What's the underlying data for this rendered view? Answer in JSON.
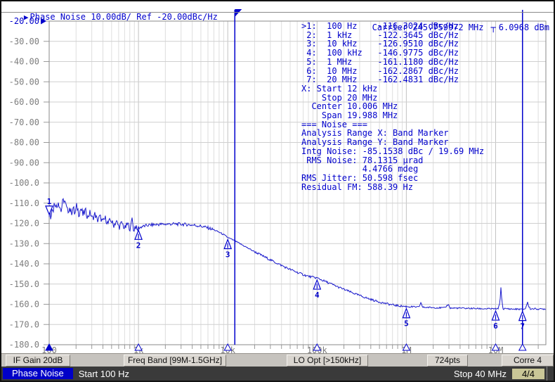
{
  "header": {
    "pointer_symbol": "▶",
    "title": "Phase Noise 10.00dB/ Ref -20.00dBc/Hz",
    "carrier": "Carrier 245.759972 MHz",
    "carrier_level_symbol": "┬",
    "power": "6.0968 dBm"
  },
  "info_panel": {
    "lines": [
      ">1:  100 Hz    -116.3024 dBc/Hz",
      " 2:  1 kHz     -122.3645 dBc/Hz",
      " 3:  10 kHz    -126.9510 dBc/Hz",
      " 4:  100 kHz   -146.9775 dBc/Hz",
      " 5:  1 MHz     -161.1180 dBc/Hz",
      " 6:  10 MHz    -162.2867 dBc/Hz",
      " 7:  20 MHz    -162.4831 dBc/Hz",
      "X: Start 12 kHz",
      "    Stop 20 MHz",
      "  Center 10.006 MHz",
      "    Span 19.988 MHz",
      "=== Noise ===",
      "Analysis Range X: Band Marker",
      "Analysis Range Y: Band Marker",
      "Intg Noise: -85.1538 dBc / 19.69 MHz",
      " RMS Noise: 78.1315 µrad",
      "            4.4766 mdeg",
      "RMS Jitter: 50.598 fsec",
      "Residual FM: 588.39 Hz"
    ]
  },
  "softkeys": [
    "IF Gain 20dB",
    "Freq Band [99M-1.5GHz]",
    "LO Opt [>150kHz]",
    "724pts",
    "Corre 4"
  ],
  "statusbar": {
    "mode": "Phase Noise",
    "start": "Start 100 Hz",
    "stop": "Stop 40 MHz",
    "page": "4/4"
  },
  "colors": {
    "accent": "#0000cc",
    "trace": "#1a1acc",
    "axis_text": "#7d7d7d",
    "grid_minor": "#dedede",
    "grid_major": "#c2c2c2",
    "grid_h": "#cfcfcf",
    "frame": "#8a8a8a",
    "tick": "#9a9a9a",
    "status_bg": "#3a3a3a",
    "page_chip_bg": "#c9c697",
    "mode_chip_bg": "#0000c8"
  },
  "chart_data": {
    "type": "line",
    "title": "Phase Noise 10.00dB/ Ref -20.00dBc/Hz",
    "x_scale": "log",
    "x_range_hz": [
      100,
      40000000
    ],
    "x_tick_values": [
      100,
      1000,
      10000,
      100000,
      1000000,
      10000000
    ],
    "x_tick_labels": [
      "100",
      "1k",
      "10k",
      "100k",
      "1M",
      "10M"
    ],
    "y_unit": "dBc/Hz",
    "y_range": [
      -180,
      -20
    ],
    "scale_per_div_db": 10,
    "ref_level_db": -20,
    "grid": true,
    "y_tick_labels": [
      "-20.00",
      "-30.00",
      "-40.00",
      "-50.00",
      "-60.00",
      "-70.00",
      "-80.00",
      "-90.00",
      "-100.0",
      "-110.0",
      "-120.0",
      "-130.0",
      "-140.0",
      "-150.0",
      "-160.0",
      "-170.0",
      "-180.0"
    ],
    "band_marker_start_hz": 12000,
    "band_marker_stop_hz": 20000000,
    "markers": [
      {
        "n": 1,
        "freq_hz": 100,
        "dbc_hz": -116.3024,
        "selected": true
      },
      {
        "n": 2,
        "freq_hz": 1000,
        "dbc_hz": -122.3645,
        "selected": false
      },
      {
        "n": 3,
        "freq_hz": 10000,
        "dbc_hz": -126.951,
        "selected": false
      },
      {
        "n": 4,
        "freq_hz": 100000,
        "dbc_hz": -146.9775,
        "selected": false
      },
      {
        "n": 5,
        "freq_hz": 1000000,
        "dbc_hz": -161.118,
        "selected": false
      },
      {
        "n": 6,
        "freq_hz": 10000000,
        "dbc_hz": -162.2867,
        "selected": false
      },
      {
        "n": 7,
        "freq_hz": 20000000,
        "dbc_hz": -162.4831,
        "selected": false
      }
    ],
    "trace": [
      [
        100,
        -116.3
      ],
      [
        102,
        -110.6
      ],
      [
        104,
        -117.6
      ],
      [
        107,
        -111.2
      ],
      [
        110,
        -114.5
      ],
      [
        113,
        -111.0
      ],
      [
        117,
        -109.2
      ],
      [
        121,
        -112.8
      ],
      [
        126,
        -108.4
      ],
      [
        131,
        -111.5
      ],
      [
        136,
        -113.8
      ],
      [
        141,
        -110.2
      ],
      [
        147,
        -108.0
      ],
      [
        153,
        -111.0
      ],
      [
        160,
        -114.2
      ],
      [
        168,
        -111.8
      ],
      [
        176,
        -114.8
      ],
      [
        185,
        -112.2
      ],
      [
        194,
        -115.6
      ],
      [
        204,
        -111.4
      ],
      [
        215,
        -115.0
      ],
      [
        227,
        -112.6
      ],
      [
        240,
        -116.2
      ],
      [
        254,
        -113.4
      ],
      [
        270,
        -117.0
      ],
      [
        287,
        -114.6
      ],
      [
        305,
        -117.8
      ],
      [
        325,
        -115.4
      ],
      [
        347,
        -118.6
      ],
      [
        371,
        -116.6
      ],
      [
        397,
        -119.4
      ],
      [
        425,
        -117.4
      ],
      [
        456,
        -120.2
      ],
      [
        489,
        -118.2
      ],
      [
        525,
        -121.0
      ],
      [
        564,
        -119.0
      ],
      [
        607,
        -121.8
      ],
      [
        653,
        -119.8
      ],
      [
        703,
        -122.6
      ],
      [
        757,
        -120.2
      ],
      [
        815,
        -123.0
      ],
      [
        855,
        -115.8
      ],
      [
        878,
        -124.2
      ],
      [
        920,
        -121.0
      ],
      [
        960,
        -123.4
      ],
      [
        1000,
        -122.3645
      ],
      [
        1100,
        -121.6
      ],
      [
        1250,
        -121.0
      ],
      [
        1450,
        -120.7
      ],
      [
        1700,
        -120.5
      ],
      [
        2000,
        -120.4
      ],
      [
        2400,
        -120.3
      ],
      [
        2900,
        -120.4
      ],
      [
        3500,
        -120.6
      ],
      [
        4200,
        -120.9
      ],
      [
        5000,
        -121.4
      ],
      [
        6000,
        -122.2
      ],
      [
        7000,
        -123.2
      ],
      [
        8200,
        -124.6
      ],
      [
        9000,
        -125.6
      ],
      [
        10000,
        -126.951
      ],
      [
        11500,
        -128.3
      ],
      [
        13500,
        -129.9
      ],
      [
        16000,
        -131.7
      ],
      [
        19000,
        -133.5
      ],
      [
        23000,
        -135.4
      ],
      [
        27000,
        -137.0
      ],
      [
        32000,
        -138.7
      ],
      [
        38000,
        -140.3
      ],
      [
        45000,
        -141.9
      ],
      [
        54000,
        -143.4
      ],
      [
        64000,
        -144.7
      ],
      [
        76000,
        -145.9
      ],
      [
        88000,
        -146.6
      ],
      [
        100000,
        -146.9775
      ],
      [
        120000,
        -148.5
      ],
      [
        145000,
        -150.0
      ],
      [
        175000,
        -151.6
      ],
      [
        210000,
        -153.0
      ],
      [
        255000,
        -154.5
      ],
      [
        310000,
        -155.9
      ],
      [
        375000,
        -157.2
      ],
      [
        450000,
        -158.3
      ],
      [
        545000,
        -159.3
      ],
      [
        660000,
        -160.1
      ],
      [
        800000,
        -160.7
      ],
      [
        900000,
        -160.95
      ],
      [
        1000000,
        -161.118
      ],
      [
        1200000,
        -161.3
      ],
      [
        1400000,
        -161.4
      ],
      [
        1450000,
        -158.9
      ],
      [
        1520000,
        -161.5
      ],
      [
        1800000,
        -161.6
      ],
      [
        2200000,
        -161.7
      ],
      [
        2700000,
        -161.8
      ],
      [
        2950000,
        -160.0
      ],
      [
        3100000,
        -161.9
      ],
      [
        3800000,
        -161.9
      ],
      [
        4700000,
        -162.0
      ],
      [
        5800000,
        -162.1
      ],
      [
        7200000,
        -162.2
      ],
      [
        8800000,
        -162.25
      ],
      [
        10000000,
        -162.2867
      ],
      [
        10700000,
        -162.3
      ],
      [
        11200000,
        -158.5
      ],
      [
        11450000,
        -151.8
      ],
      [
        11750000,
        -158.0
      ],
      [
        12100000,
        -162.3
      ],
      [
        13500000,
        -162.2
      ],
      [
        15500000,
        -162.4
      ],
      [
        18000000,
        -162.4
      ],
      [
        20000000,
        -162.4831
      ],
      [
        21500000,
        -162.2
      ],
      [
        22800000,
        -159.0
      ],
      [
        23400000,
        -161.0
      ],
      [
        24500000,
        -162.3
      ],
      [
        27000000,
        -162.2
      ],
      [
        31000000,
        -162.4
      ],
      [
        36000000,
        -162.3
      ],
      [
        40000000,
        -162.4
      ]
    ]
  }
}
